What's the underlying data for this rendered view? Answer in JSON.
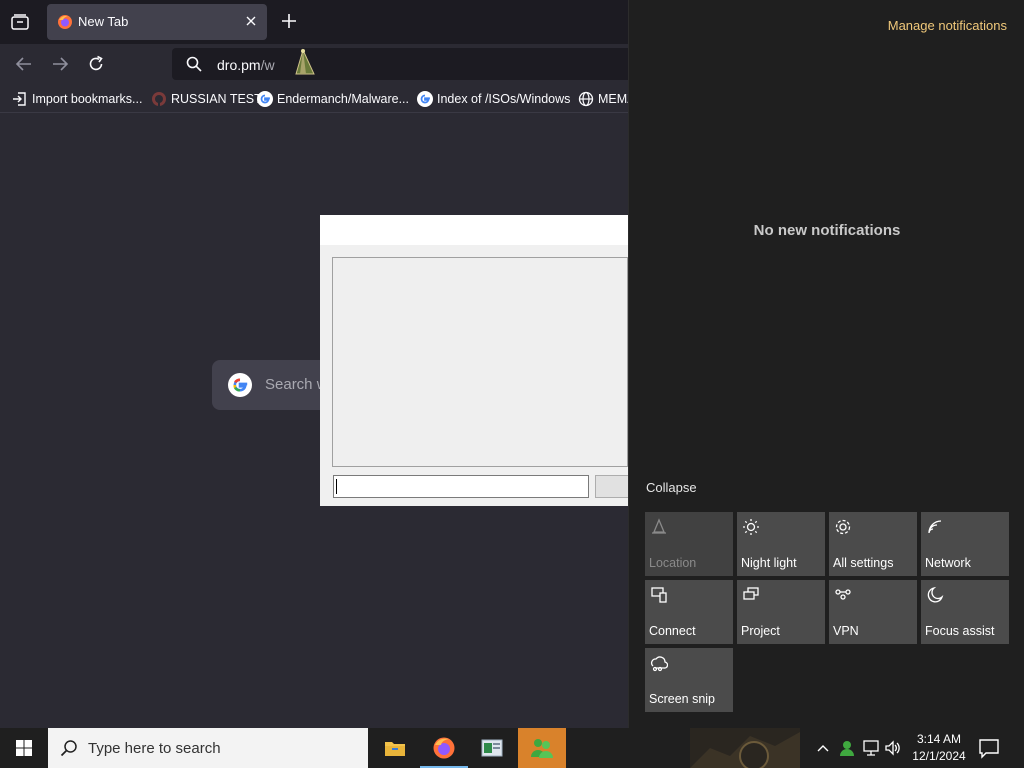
{
  "browser": {
    "tab": {
      "title": "New Tab"
    },
    "url": {
      "main": "dro.pm",
      "rest": "/w"
    },
    "bookmarks": [
      {
        "label": "Import bookmarks...",
        "icon": "import-icon"
      },
      {
        "label": "RUSSIAN TEST",
        "icon": "github-icon"
      },
      {
        "label": "Endermanch/Malware...",
        "icon": "google-icon"
      },
      {
        "label": "Index of /ISOs/Windows",
        "icon": "google-icon"
      },
      {
        "label": "MEMZ",
        "icon": "globe-icon"
      }
    ],
    "search_placeholder": "Search w"
  },
  "action_center": {
    "manage": "Manage notifications",
    "empty": "No new notifications",
    "collapse": "Collapse",
    "tiles": [
      {
        "label": "Location",
        "icon": "location-icon",
        "enabled": false
      },
      {
        "label": "Night light",
        "icon": "brightness-icon",
        "enabled": true
      },
      {
        "label": "All settings",
        "icon": "gear-icon",
        "enabled": true
      },
      {
        "label": "Network",
        "icon": "network-icon",
        "enabled": true
      },
      {
        "label": "Connect",
        "icon": "connect-icon",
        "enabled": true
      },
      {
        "label": "Project",
        "icon": "project-icon",
        "enabled": true
      },
      {
        "label": "VPN",
        "icon": "vpn-icon",
        "enabled": true
      },
      {
        "label": "Focus assist",
        "icon": "moon-icon",
        "enabled": true
      },
      {
        "label": "Screen snip",
        "icon": "snip-icon",
        "enabled": true
      }
    ]
  },
  "taskbar": {
    "search_placeholder": "Type here to search",
    "time": "3:14 AM",
    "date": "12/1/2024",
    "accent": "#76b9ed"
  }
}
